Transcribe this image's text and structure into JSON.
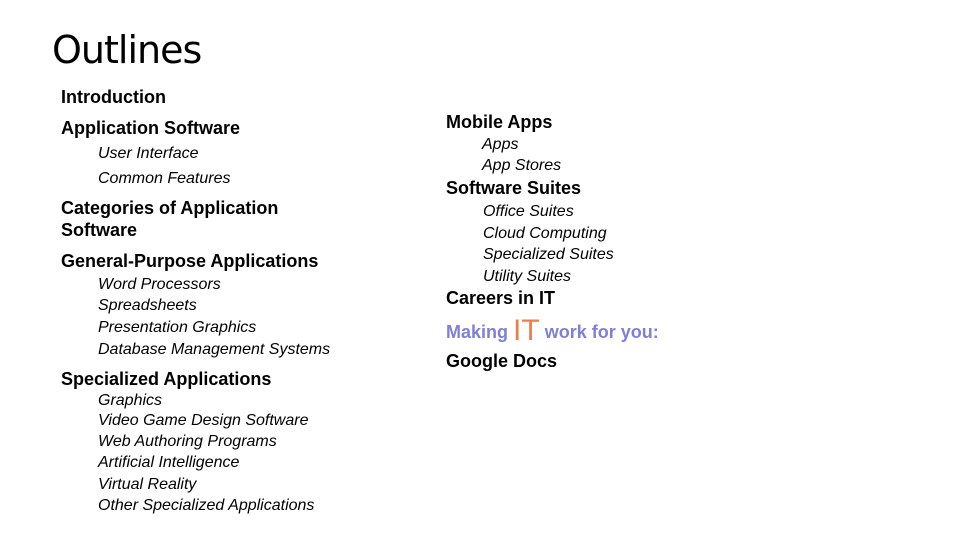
{
  "slide": {
    "title": "Outlines",
    "left": {
      "introduction": "Introduction",
      "application_software": {
        "heading": "Application Software",
        "items": [
          "User Interface",
          "Common Features"
        ]
      },
      "categories": "Categories of Application Software",
      "categories_line1": "Categories of Application",
      "categories_line2": "Software",
      "general_purpose": {
        "heading": "General-Purpose Applications",
        "items": [
          "Word Processors",
          "Spreadsheets",
          "Presentation Graphics",
          "Database Management Systems"
        ]
      },
      "specialized": {
        "heading": "Specialized Applications",
        "items": [
          "Graphics",
          "Video Game Design Software",
          "Web Authoring Programs",
          "Artificial Intelligence",
          "Virtual Reality",
          "Other Specialized Applications"
        ]
      }
    },
    "right": {
      "mobile_apps": {
        "heading": "Mobile Apps",
        "items": [
          "Apps",
          "App Stores"
        ]
      },
      "software_suites": {
        "heading": "Software Suites",
        "items": [
          "Office Suites",
          "Cloud Computing",
          "Specialized Suites",
          "Utility Suites"
        ]
      },
      "careers": "Careers in IT",
      "making_it": {
        "prefix": "Making",
        "highlight": "IT",
        "suffix": "work for you:",
        "prefix_color": "#7f7fd5",
        "highlight_color": "#ed7d4f"
      },
      "google_docs": "Google Docs"
    }
  }
}
